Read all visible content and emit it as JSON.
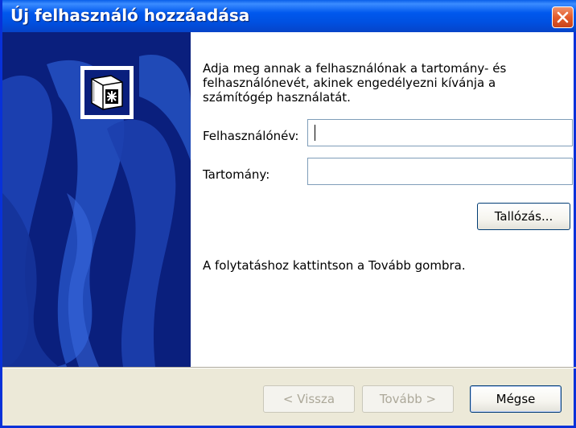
{
  "window": {
    "title": "Új felhasználó hozzáadása",
    "close_icon": "close-icon"
  },
  "side_panel": {
    "icon": "key-card-icon",
    "background_color": "#0a1f7d"
  },
  "content": {
    "intro": "Adja meg annak a felhasználónak a tartomány- és felhasználónevét, akinek engedélyezni kívánja a számítógép használatát.",
    "username_label": "Felhasználónév:",
    "username_value": "",
    "domain_label": "Tartomány:",
    "domain_value": "",
    "browse_label": "Tallózás...",
    "hint": "A folytatáshoz kattintson a Tovább gombra."
  },
  "footer": {
    "back_label": "< Vissza",
    "next_label": "Tovább >",
    "cancel_label": "Mégse"
  },
  "colors": {
    "titlebar": "#0058ee",
    "window_border": "#0831d9",
    "dialog_bg": "#ece9d8",
    "close_button": "#e35b2a"
  }
}
